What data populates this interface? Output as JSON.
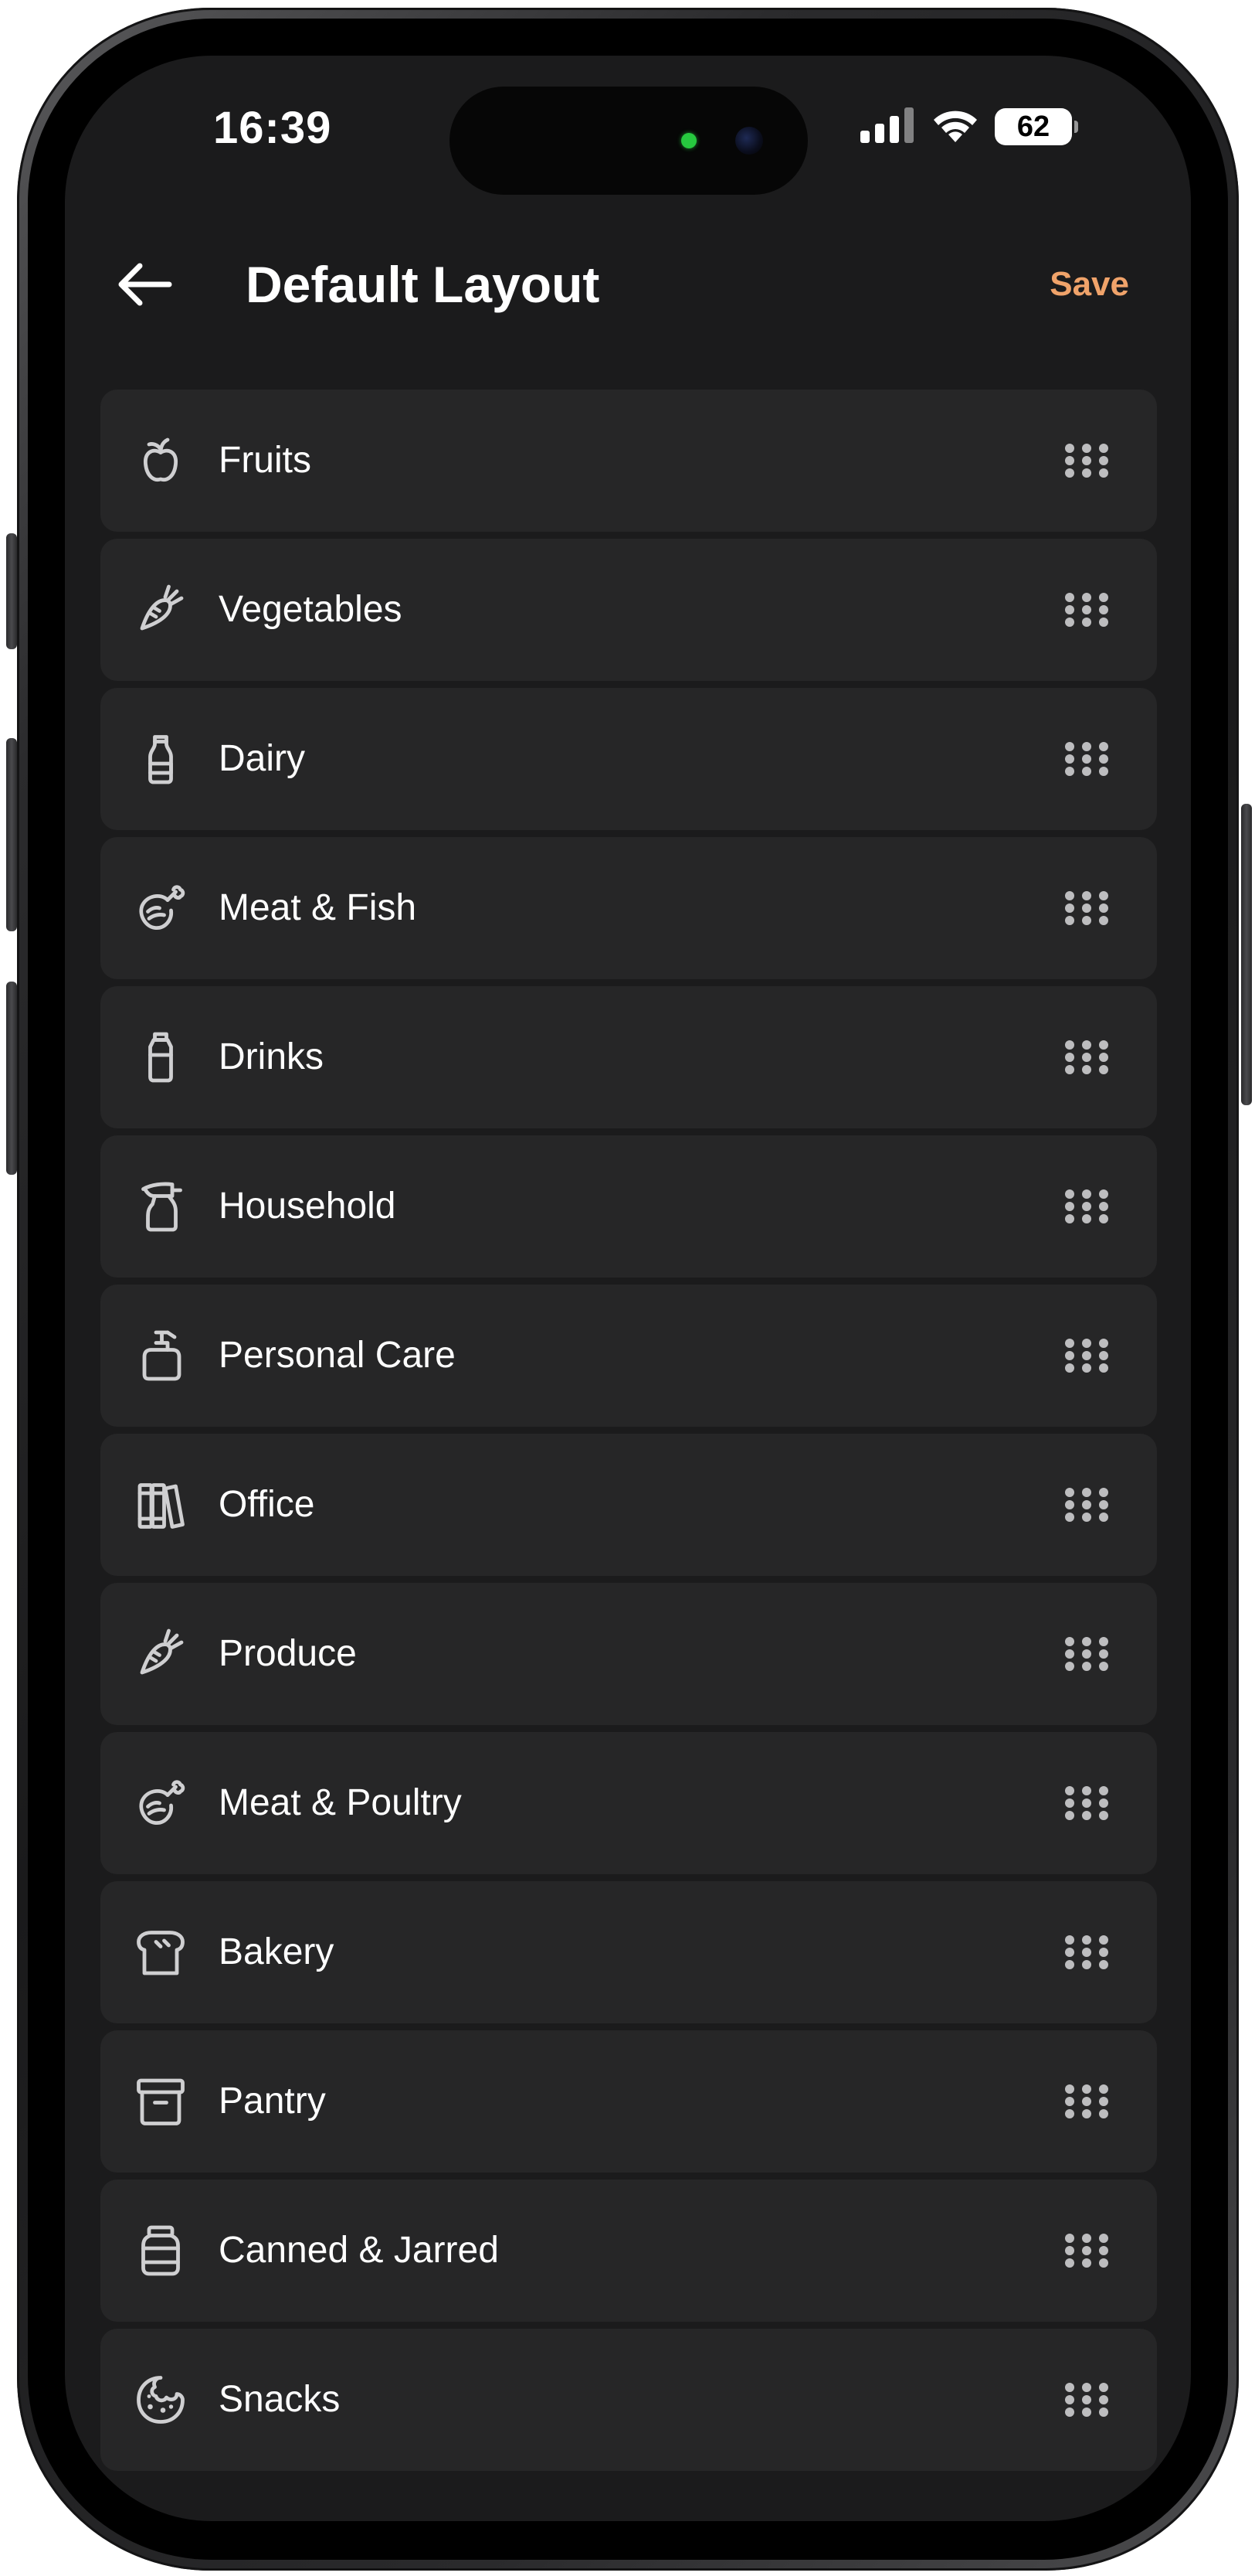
{
  "status_bar": {
    "time": "16:39",
    "battery": "62",
    "battery_level": 0.62,
    "icons": [
      "cellular-signal-icon",
      "wifi-icon",
      "battery-icon"
    ]
  },
  "header": {
    "back_icon": "arrow-left-icon",
    "title": "Default Layout",
    "save_label": "Save"
  },
  "colors": {
    "background": "#1b1b1c",
    "row_background": "#262627",
    "accent": "#f0a36a",
    "text": "#ffffff",
    "icon": "#cfcfd1"
  },
  "categories": [
    {
      "label": "Fruits",
      "icon": "apple-icon"
    },
    {
      "label": "Vegetables",
      "icon": "carrot-icon"
    },
    {
      "label": "Dairy",
      "icon": "milk-bottle-icon"
    },
    {
      "label": "Meat & Fish",
      "icon": "drumstick-icon"
    },
    {
      "label": "Drinks",
      "icon": "drink-bottle-icon"
    },
    {
      "label": "Household",
      "icon": "spray-bottle-icon"
    },
    {
      "label": "Personal Care",
      "icon": "soap-dispenser-icon"
    },
    {
      "label": "Office",
      "icon": "books-icon"
    },
    {
      "label": "Produce",
      "icon": "carrot-icon"
    },
    {
      "label": "Meat & Poultry",
      "icon": "drumstick-icon"
    },
    {
      "label": "Bakery",
      "icon": "bread-icon"
    },
    {
      "label": "Pantry",
      "icon": "storage-box-icon"
    },
    {
      "label": "Canned & Jarred",
      "icon": "jar-icon"
    },
    {
      "label": "Snacks",
      "icon": "cookie-icon"
    }
  ],
  "drag_handle_icon": "drag-handle-icon"
}
